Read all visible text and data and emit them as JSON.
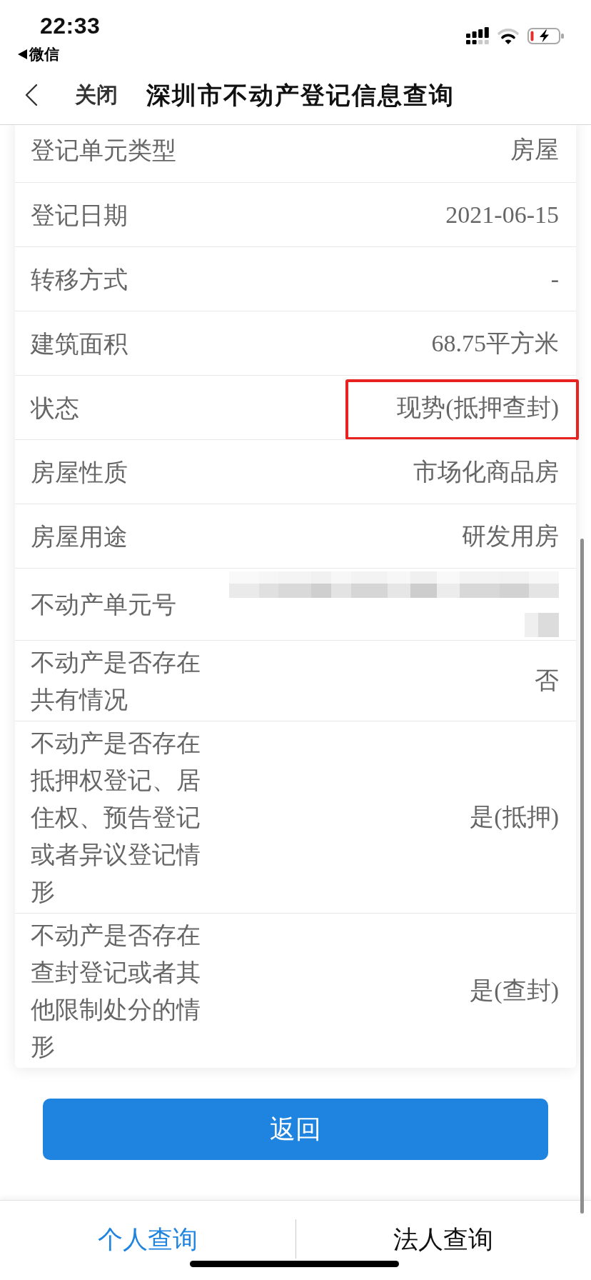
{
  "status_bar": {
    "time": "22:33",
    "back_app": "微信"
  },
  "nav": {
    "close": "关闭",
    "title": "深圳市不动产登记信息查询"
  },
  "rows": [
    {
      "label": "登记单元类型",
      "kind": "text",
      "value": "房屋",
      "highlighted": false
    },
    {
      "label": "登记日期",
      "kind": "text",
      "value": "2021-06-15",
      "highlighted": false
    },
    {
      "label": "转移方式",
      "kind": "text",
      "value": "-",
      "highlighted": false
    },
    {
      "label": "建筑面积",
      "kind": "text",
      "value": "68.75平方米",
      "highlighted": false
    },
    {
      "label": "状态",
      "kind": "text",
      "value": "现势(抵押查封)",
      "highlighted": true
    },
    {
      "label": "房屋性质",
      "kind": "text",
      "value": "市场化商品房",
      "highlighted": false
    },
    {
      "label": "房屋用途",
      "kind": "text",
      "value": "研发用房",
      "highlighted": false
    },
    {
      "label": "不动产单元号",
      "kind": "redacted",
      "highlighted": false
    },
    {
      "label": "不动产是否存在共有情况",
      "kind": "text",
      "value": "否",
      "highlighted": false
    },
    {
      "label": "不动产是否存在抵押权登记、居住权、预告登记或者异议登记情形",
      "kind": "text",
      "value": "是(抵押)",
      "highlighted": false
    },
    {
      "label": "不动产是否存在查封登记或者其他限制处分的情形",
      "kind": "text",
      "value": "是(查封)",
      "highlighted": false
    }
  ],
  "back_button": "返回",
  "tabs": [
    {
      "label": "个人查询",
      "selected": true
    },
    {
      "label": "法人查询",
      "selected": false
    }
  ]
}
